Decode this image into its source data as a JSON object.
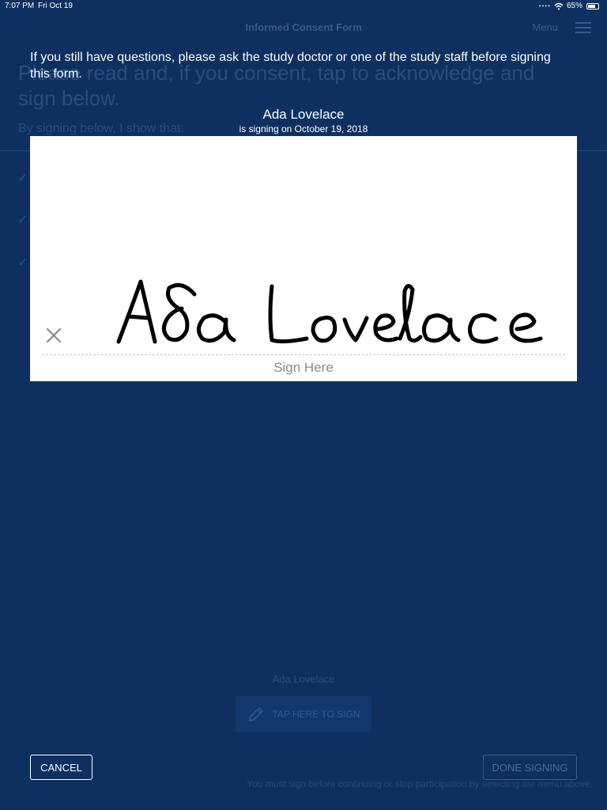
{
  "status_bar": {
    "time": "7:07 PM",
    "date": "Fri Oct 19",
    "battery": "65%",
    "battery_level": 0.65,
    "signal_icon": "signal-dots-icon",
    "wifi_icon": "wifi-icon"
  },
  "nav": {
    "title": "Informed Consent Form",
    "menu_label": "Menu",
    "menu_icon": "hamburger-icon"
  },
  "background": {
    "heading": "Please read and, if you consent, tap to acknowledge and sign below.",
    "subheading": "By signing below, I show that:",
    "checks": [
      "✓",
      "✓",
      "✓"
    ],
    "signer_label": "Ada Lovelace",
    "tap_to_sign_label": "TAP HERE TO SIGN",
    "done_label": "DONE SIGNING",
    "note": "You must sign before continuing or stop participation by selecting the menu above."
  },
  "overlay": {
    "instructions": "If you still have questions, please ask the study doctor or one of the study staff before signing this form.",
    "signer_name": "Ada Lovelace",
    "signing_date": "is signing on October 19, 2018",
    "signature_text": "Ada Lovelace",
    "sign_here_label": "Sign Here",
    "clear_icon": "close-icon",
    "cancel_label": "CANCEL"
  },
  "colors": {
    "background": "#0d3060",
    "panel": "#ffffff",
    "ink": "#000000"
  }
}
